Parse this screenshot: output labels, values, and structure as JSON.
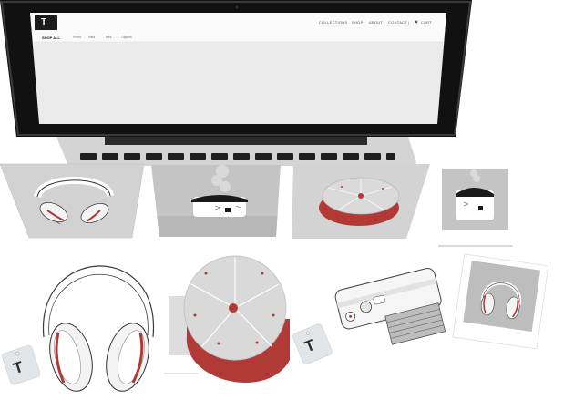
{
  "site": {
    "logo_letter": "T",
    "nav": [
      "COLLECTIONS",
      "SHOP",
      "ABOUT",
      "CONTACT"
    ],
    "cart_label": "CART",
    "subnav_title": "SHOP ALL",
    "subnav_items": [
      "Prints",
      "Hats",
      "Tees",
      "Objects"
    ]
  },
  "tags": {
    "letter": "T"
  },
  "colors": {
    "laptop_body": "#111111",
    "screen_bg": "#ebebeb",
    "accent_red": "#b23a36",
    "card_gray": "#c9c9c9",
    "tag_bg": "#e3e6e8"
  },
  "icons": [
    "cart-icon",
    "steam-icon"
  ]
}
